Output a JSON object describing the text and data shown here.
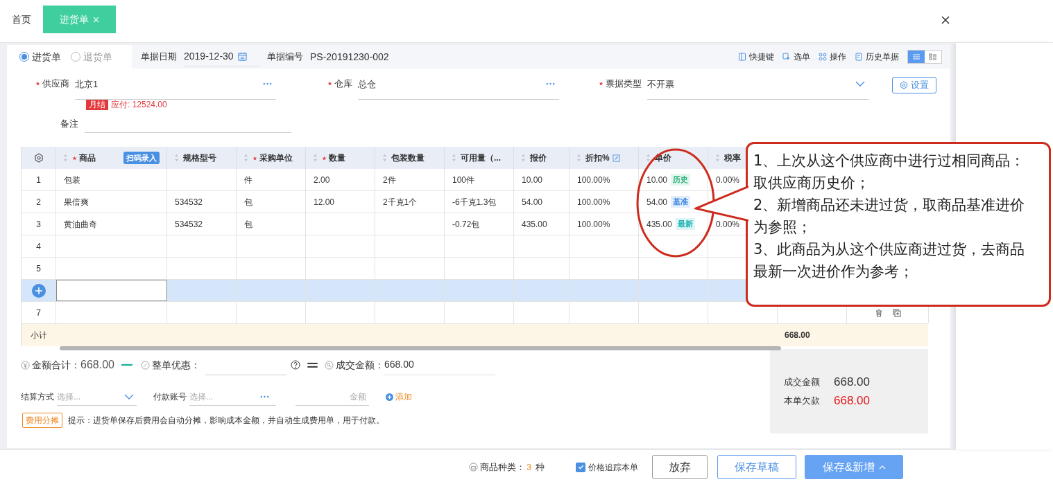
{
  "tabs": [
    {
      "label": "首页",
      "selected": false,
      "closable": false
    },
    {
      "label": "进货单",
      "selected": true,
      "closable": true
    }
  ],
  "doc_types": [
    {
      "label": "进货单",
      "selected": true
    },
    {
      "label": "退货单",
      "selected": false
    }
  ],
  "doc_date": {
    "label": "单据日期",
    "value": "2019-12-30"
  },
  "doc_number": {
    "label": "单据编号",
    "value": "PS-20191230-002"
  },
  "toolbar": [
    {
      "label": "快捷键",
      "kind": "keyboard"
    },
    {
      "label": "选单",
      "kind": "select"
    },
    {
      "label": "操作",
      "kind": "grid"
    },
    {
      "label": "历史单据",
      "kind": "history"
    }
  ],
  "view_modes": [
    {
      "kind": "list",
      "selected": true
    },
    {
      "kind": "detail",
      "selected": false
    }
  ],
  "fields": [
    {
      "label": "供应商",
      "required": true,
      "value": "北京1",
      "kind": "lookup"
    },
    {
      "label": "仓库",
      "required": true,
      "value": "总仓",
      "kind": "lookup"
    },
    {
      "label": "票据类型",
      "required": true,
      "value": "不开票",
      "kind": "dropdown"
    }
  ],
  "settings_button": "设置",
  "supplier_badge": "月结",
  "payable": "应付: 12524.00",
  "remark": {
    "label": "备注"
  },
  "table": {
    "columns": [
      {
        "kind": "settings"
      },
      {
        "label": "商品",
        "sortable": true,
        "required": true,
        "button": "扫码录入"
      },
      {
        "label": "规格型号",
        "sortable": true,
        "required": false
      },
      {
        "label": "采购单位",
        "sortable": true,
        "required": true
      },
      {
        "label": "数量",
        "sortable": true,
        "required": true
      },
      {
        "label": "包装数量",
        "sortable": true,
        "required": false
      },
      {
        "label": "可用量（...",
        "sortable": true,
        "required": false
      },
      {
        "label": "报价",
        "sortable": true,
        "required": false
      },
      {
        "label": "折扣%",
        "sortable": true,
        "required": false,
        "editable": true
      },
      {
        "label": "单价",
        "sortable": true,
        "required": false
      },
      {
        "label": "税率",
        "sortable": true,
        "required": false
      }
    ],
    "rows": [
      {
        "kind": "data",
        "number": "1",
        "selected": false,
        "product": "包装",
        "unit": "件",
        "qty": "2.00",
        "pack_qty": "2件",
        "available": "100件",
        "quote": "10.00",
        "discount": "100.00%",
        "price": "10.00",
        "tag": {
          "text": "历史",
          "kind": "history"
        },
        "tax": "0.00%"
      },
      {
        "kind": "data",
        "number": "2",
        "selected": false,
        "product": "果倍爽",
        "spec": "534532",
        "unit": "包",
        "qty": "12.00",
        "pack_qty": "2千克1个",
        "available": "-6千克1.3包",
        "quote": "54.00",
        "discount": "100.00%",
        "price": "54.00",
        "tag": {
          "text": "基准",
          "kind": "base"
        }
      },
      {
        "kind": "data",
        "number": "3",
        "selected": false,
        "product": "黄油曲奇",
        "spec": "534532",
        "unit": "包",
        "available": "-0.72包",
        "quote": "435.00",
        "discount": "100.00%",
        "price": "435.00",
        "tag": {
          "text": "最新",
          "kind": "latest"
        },
        "tax": "0.00%"
      },
      {
        "kind": "data",
        "number": "4",
        "selected": false
      },
      {
        "kind": "data",
        "number": "5",
        "selected": false
      },
      {
        "kind": "new",
        "selected": true
      },
      {
        "kind": "data",
        "number": "7",
        "selected": false,
        "show_actions": true
      }
    ],
    "subtotal": {
      "label": "小计",
      "total": "668.00"
    }
  },
  "callout": [
    "1、上次从这个供应商中进行过相同商品：取供应商历史价；",
    "2、新增商品还未进过货，取商品基准进价为参照；",
    "3、此商品为从这个供应商进过货，去商品最新一次进价作为参考；"
  ],
  "totals": {
    "amount_label": "金额合计：",
    "amount": "668.00",
    "discount_label": "整单优惠：",
    "deal_label": "成交金额：",
    "deal": "668.00"
  },
  "payment": {
    "method_label": "结算方式",
    "method_placeholder": "选择...",
    "account_label": "付款账号",
    "account_placeholder": "选择...",
    "amount_placeholder": "金额",
    "add": "添加"
  },
  "expense_button": "费用分摊",
  "hint": "提示：进货单保存后费用会自动分摊，影响成本金额，并自动生成费用单，用于付款。",
  "summary": [
    {
      "label": "成交金额",
      "value": "668.00",
      "kind": "normal"
    },
    {
      "label": "本单欠款",
      "value": "668.00",
      "kind": "debt"
    }
  ],
  "footer": {
    "kinds_label": "商品种类：",
    "kinds_count": "3",
    "kinds_unit": "种",
    "track": {
      "label": "价格追踪本单",
      "checked": true
    },
    "buttons": [
      {
        "label": "放弃",
        "kind": "plain"
      },
      {
        "label": "保存草稿",
        "kind": "outline"
      },
      {
        "label": "保存&新增",
        "kind": "primary"
      }
    ]
  }
}
